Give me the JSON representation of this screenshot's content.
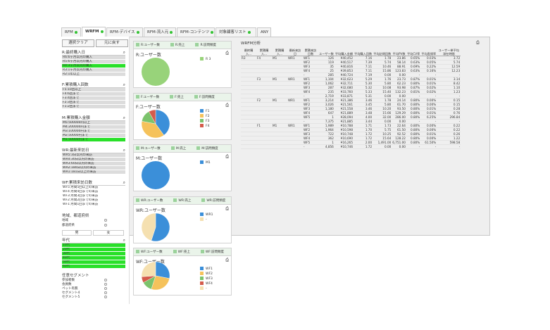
{
  "tabs": [
    {
      "label": "RFM",
      "dot": true
    },
    {
      "label": "WRFM",
      "dot": true,
      "active": true
    },
    {
      "label": "RFM-デバイス",
      "dot": true
    },
    {
      "label": "RFM-流入元",
      "dot": true
    },
    {
      "label": "RFM-コンテンツ",
      "dot": true
    },
    {
      "label": "対象顧客リスト",
      "dot": true
    },
    {
      "label": "ANY",
      "dot": false
    }
  ],
  "buttons": {
    "clear": "選択クリア",
    "back": "元に戻す"
  },
  "filters": {
    "r": {
      "title": "R:最終購入日",
      "items": [
        {
          "label": "R6:6ヶ月以内の購入",
          "sel": false
        },
        {
          "label": "R5:6ヶ月以内の購入",
          "sel": false
        },
        {
          "label": "R4:3ヶ月以内の購入",
          "sel": true
        },
        {
          "label": "R3:1ヶ月以内の購入",
          "sel": false
        },
        {
          "label": "R2:1年以上",
          "sel": false
        }
      ]
    },
    "f": {
      "title": "F:累積購入回数",
      "items": [
        {
          "label": "F5:10回以上",
          "sel": false
        },
        {
          "label": "F4:6回まで",
          "sel": false
        },
        {
          "label": "F3:4回まで",
          "sel": false
        },
        {
          "label": "F2:3回まで",
          "sel": false
        },
        {
          "label": "F1:2回まで",
          "sel": false
        }
      ]
    },
    "m": {
      "title": "M:累積購入金額",
      "items": [
        {
          "label": "M5:500000円以上",
          "sel": false
        },
        {
          "label": "M4:200000円まで",
          "sel": false
        },
        {
          "label": "M3:100000円まで",
          "sel": false
        },
        {
          "label": "M2:50000円まで",
          "sel": false
        },
        {
          "label": "M1:50000円まで",
          "sel": true
        }
      ]
    },
    "wr": {
      "title": "WR:最新来訪日",
      "items": [
        {
          "label": "WR5:3日以内の来訪",
          "sel": false
        },
        {
          "label": "WR4:30日以内の来訪",
          "sel": false
        },
        {
          "label": "WR3:60日以内の来訪",
          "sel": false
        },
        {
          "label": "WR2:180日以内の来訪",
          "sel": false
        },
        {
          "label": "WR1:181日以上の来訪",
          "sel": false
        }
      ]
    },
    "wf": {
      "title": "WF:累積来訪日数",
      "items": [
        {
          "label": "WF5:月間5回以上の来訪",
          "sel": false
        },
        {
          "label": "WF4:月間4回までの来訪",
          "sel": false
        },
        {
          "label": "WF3:月間3回までの来訪",
          "sel": false
        },
        {
          "label": "WF2:月間2回までの来訪",
          "sel": false
        },
        {
          "label": "WF1:月間1回までの来訪",
          "sel": false
        }
      ]
    }
  },
  "region": {
    "title": "地域、都道府県",
    "rows": [
      "地域",
      "都道府県"
    ]
  },
  "gender": {
    "male": "男",
    "female": "女"
  },
  "age": {
    "title": "年代",
    "items": [
      "10代",
      "20代",
      "30代",
      "40代",
      "50代",
      "60代"
    ]
  },
  "segment": {
    "title": "任意セグメント",
    "rows": [
      "参加者数",
      "会員数",
      "ペット有無",
      "セグメント4",
      "セグメント5"
    ]
  },
  "panels": [
    {
      "head": [
        "R:ユーザー数",
        "R:売上",
        "R:訪問頻度"
      ],
      "title": "R:ユーザー数",
      "legend": [
        {
          "label": "R 3",
          "color": "#98d37a"
        }
      ]
    },
    {
      "head": [
        "F:ユーザー数",
        "F:売上",
        "F:訪問頻度"
      ],
      "title": "F:ユーザー数",
      "legend": [
        {
          "label": "F1",
          "color": "#3b8fd9"
        },
        {
          "label": "F2",
          "color": "#f5c25b"
        },
        {
          "label": "F3",
          "color": "#7cc36c"
        },
        {
          "label": "F4",
          "color": "#d45b4b"
        }
      ]
    },
    {
      "head": [
        "M:ユーザー数",
        "M:売上",
        "M:訪問頻度"
      ],
      "title": "M:ユーザー数",
      "legend": [
        {
          "label": "M1",
          "color": "#3b8fd9"
        }
      ]
    },
    {
      "head": [
        "WR:ユーザー数",
        "WR:売上",
        "WR:訪問頻度"
      ],
      "title": "WR:ユーザー数",
      "legend": [
        {
          "label": "WR1",
          "color": "#3b8fd9"
        },
        {
          "label": "-",
          "color": "#f5e0b0"
        }
      ]
    },
    {
      "head": [
        "WF:ユーザー数",
        "WF:売上",
        "WF:訪問頻度"
      ],
      "title": "WF:ユーザー数",
      "legend": [
        {
          "label": "WF1",
          "color": "#3b8fd9"
        },
        {
          "label": "WF2",
          "color": "#f5c25b"
        },
        {
          "label": "WF3",
          "color": "#7cc36c"
        },
        {
          "label": "WF4",
          "color": "#d45b4b"
        },
        {
          "label": "-",
          "color": "#f5e0b0"
        }
      ]
    }
  ],
  "table": {
    "title": "WRFM分析",
    "headers": [
      "最終購入...",
      "累積購入...",
      "累積購入...",
      "最新来訪日",
      "累積来訪日数",
      "ユーザー数",
      "平均購入金額",
      "平均購入回数",
      "平均訪問回数",
      "平均PV数",
      "平均CV率",
      "平均直帰率",
      "ユーザー単平均滞在時間"
    ],
    "rows": [
      [
        "R3",
        "F4",
        "M1",
        "WR1",
        "WF1",
        "126",
        "¥40,452",
        "7.16",
        "1.78",
        "23.86",
        "0.65%",
        "0.03%",
        "3.72"
      ],
      [
        "",
        "",
        "",
        "",
        "WF2",
        "119",
        "¥40,517",
        "7.39",
        "5.74",
        "58.14",
        "0.63%",
        "0.05%",
        "5.74"
      ],
      [
        "",
        "",
        "",
        "",
        "WF3",
        "35",
        "¥40,816",
        "7.11",
        "10.46",
        "88.91",
        "0.69%",
        "0.22%",
        "12.59"
      ],
      [
        "",
        "",
        "",
        "",
        "WF4",
        "25",
        "¥39,853",
        "7.11",
        "15.86",
        "123.83",
        "0.63%",
        "0.16%",
        "12.23"
      ],
      [
        "",
        "",
        "",
        "",
        "-",
        "285",
        "¥40,724",
        "7.19",
        "0.00",
        "0.00",
        "-",
        "-",
        "-"
      ],
      [
        "",
        "F3",
        "M1",
        "WR1",
        "WF1",
        "1,104",
        "¥32,623",
        "5.29",
        "1.76",
        "23.73",
        "0.87%",
        "0.01%",
        "3.14"
      ],
      [
        "",
        "",
        "",
        "",
        "WF2",
        "1,062",
        "¥32,711",
        "5.30",
        "5.80",
        "62.23",
        "0.80%",
        "0.01%",
        "8.42"
      ],
      [
        "",
        "",
        "",
        "",
        "WF3",
        "287",
        "¥32,680",
        "5.32",
        "10.08",
        "93.98",
        "0.87%",
        "0.02%",
        "1.10"
      ],
      [
        "",
        "",
        "",
        "",
        "WF4",
        "235",
        "¥33,760",
        "5.33",
        "15.40",
        "132.23",
        "0.81%",
        "0.02%",
        "1.23"
      ],
      [
        "",
        "",
        "",
        "",
        "-",
        "2,719",
        "¥33,871",
        "5.31",
        "0.00",
        "0.00",
        "-",
        "-",
        "-"
      ],
      [
        "",
        "F2",
        "M1",
        "WR1",
        "WF1",
        "3,214",
        "¥21,386",
        "3.46",
        "1.78",
        "24.14",
        "0.80%",
        "0.00%",
        "0.15"
      ],
      [
        "",
        "",
        "",
        "",
        "WF2",
        "3,026",
        "¥21,561",
        "3.45",
        "5.80",
        "61.70",
        "0.80%",
        "0.00%",
        "0.15"
      ],
      [
        "",
        "",
        "",
        "",
        "WF3",
        "1,180",
        "¥21,558",
        "3.46",
        "10.20",
        "93.50",
        "0.80%",
        "0.01%",
        "0.28"
      ],
      [
        "",
        "",
        "",
        "",
        "WF4",
        "647",
        "¥21,889",
        "3.48",
        "15.66",
        "129.29",
        "0.80%",
        "0.01%",
        "0.76"
      ],
      [
        "",
        "",
        "",
        "",
        "WF5",
        "1",
        "¥28,094",
        "4.00",
        "32.00",
        "286.00",
        "0.80%",
        "6.25%",
        "296.84"
      ],
      [
        "",
        "",
        "",
        "",
        "-",
        "7,375",
        "¥21,885",
        "3.44",
        "0.00",
        "0.00",
        "-",
        "-",
        "-"
      ],
      [
        "",
        "F1",
        "M1",
        "WR1",
        "WF1",
        "1,989",
        "¥10,788",
        "1.71",
        "1.73",
        "22.64",
        "0.80%",
        "0.00%",
        "0.22"
      ],
      [
        "",
        "",
        "",
        "",
        "WF2",
        "1,964",
        "¥10,598",
        "1.70",
        "5.75",
        "61.50",
        "0.80%",
        "0.00%",
        "0.22"
      ],
      [
        "",
        "",
        "",
        "",
        "WF3",
        "722",
        "¥10,748",
        "1.72",
        "10.25",
        "92.52",
        "0.80%",
        "0.01%",
        "0.26"
      ],
      [
        "",
        "",
        "",
        "",
        "WF4",
        "362",
        "¥10,690",
        "1.72",
        "15.64",
        "128.22",
        "0.80%",
        "0.00%",
        "1.22"
      ],
      [
        "",
        "",
        "",
        "",
        "WF5",
        "1",
        "¥16,265",
        "2.00",
        "1,491.00",
        "6,751.00",
        "0.80%",
        "61.50%",
        "598.58"
      ],
      [
        "",
        "",
        "",
        "",
        "-",
        "4,856",
        "¥10,746",
        "1.72",
        "0.00",
        "0.00",
        "-",
        "-",
        "-"
      ]
    ]
  }
}
